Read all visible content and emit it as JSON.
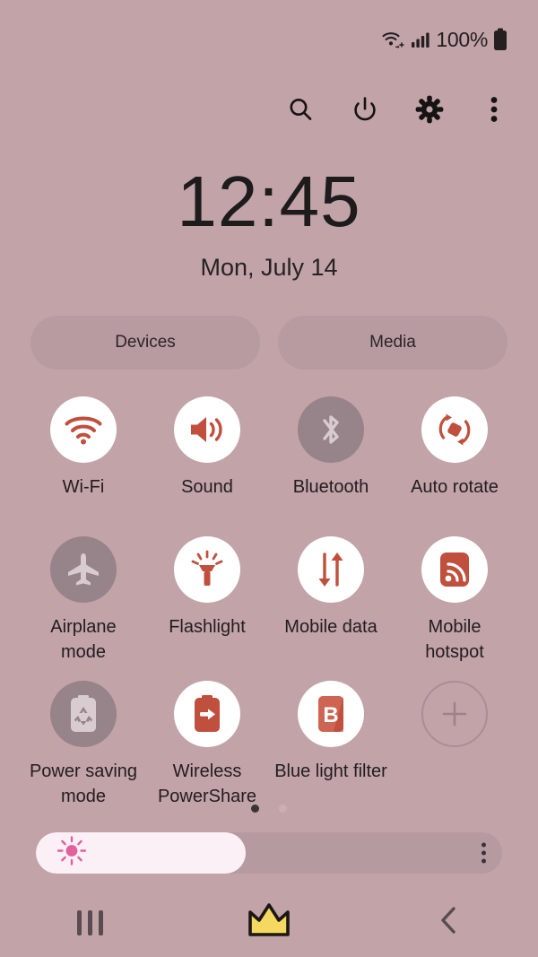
{
  "statusbar": {
    "wifi_icon": "wifi-calling-icon",
    "signal_icon": "cellular-signal-icon",
    "battery_percent": "100%",
    "battery_icon": "battery-full-icon"
  },
  "quick_icons": [
    {
      "name": "search-icon",
      "label": "Search"
    },
    {
      "name": "power-icon",
      "label": "Power"
    },
    {
      "name": "settings-icon",
      "label": "Settings"
    },
    {
      "name": "more-options-icon",
      "label": "More options"
    }
  ],
  "clock": {
    "time": "12:45",
    "date": "Mon, July 14"
  },
  "pills": [
    {
      "label": "Devices"
    },
    {
      "label": "Media"
    }
  ],
  "tiles": [
    {
      "label": "Wi-Fi",
      "icon": "wifi-icon",
      "state": "on"
    },
    {
      "label": "Sound",
      "icon": "sound-icon",
      "state": "on"
    },
    {
      "label": "Bluetooth",
      "icon": "bluetooth-icon",
      "state": "off"
    },
    {
      "label": "Auto rotate",
      "icon": "auto-rotate-icon",
      "state": "on"
    },
    {
      "label": "Airplane mode",
      "icon": "airplane-icon",
      "state": "off"
    },
    {
      "label": "Flashlight",
      "icon": "flashlight-icon",
      "state": "on"
    },
    {
      "label": "Mobile data",
      "icon": "mobile-data-icon",
      "state": "on"
    },
    {
      "label": "Mobile hotspot",
      "icon": "hotspot-icon",
      "state": "on"
    },
    {
      "label": "Power saving mode",
      "icon": "power-saving-icon",
      "state": "off"
    },
    {
      "label": "Wireless PowerShare",
      "icon": "wireless-powershare-icon",
      "state": "on"
    },
    {
      "label": "Blue light filter",
      "icon": "blue-light-filter-icon",
      "state": "on"
    },
    {
      "label": "",
      "icon": "add-icon",
      "state": "add"
    }
  ],
  "pager": {
    "total": 2,
    "active": 1
  },
  "brightness": {
    "value": 45,
    "icon": "brightness-sun-icon",
    "menu_icon": "slider-more-options-icon"
  },
  "navbar": [
    {
      "name": "recents-button",
      "icon": "recents-icon"
    },
    {
      "name": "home-button",
      "icon": "crown-home-icon"
    },
    {
      "name": "back-button",
      "icon": "back-chevron-icon"
    }
  ],
  "colors": {
    "background": "#c2a3a8",
    "accent": "#c0503d",
    "tile_on": "#ffffff",
    "tile_off": "#97838a",
    "slider_fill": "#fbf0f6",
    "crown": "#f5d860"
  }
}
